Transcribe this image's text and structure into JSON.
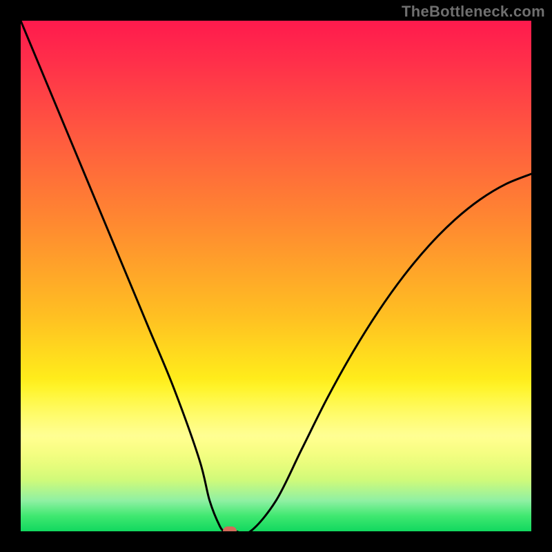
{
  "watermark": "TheBottleneck.com",
  "colors": {
    "frame": "#000000",
    "curve_stroke": "#000000",
    "marker_fill": "#d36b5a",
    "gradient_top": "#ff1a4d",
    "gradient_bottom": "#12d85f",
    "watermark_text": "#6f6f6f"
  },
  "chart_data": {
    "type": "line",
    "title": "",
    "xlabel": "",
    "ylabel": "",
    "xlim": [
      0,
      100
    ],
    "ylim": [
      0,
      100
    ],
    "grid": false,
    "series": [
      {
        "name": "bottleneck-curve",
        "x": [
          0,
          5,
          10,
          15,
          20,
          25,
          30,
          35,
          37,
          39,
          40,
          41,
          42,
          45,
          50,
          55,
          60,
          65,
          70,
          75,
          80,
          85,
          90,
          95,
          100
        ],
        "y": [
          100,
          88,
          76,
          64,
          52,
          40,
          28,
          14,
          6,
          1,
          0,
          0,
          0,
          0,
          6,
          16,
          26,
          35,
          43,
          50,
          56,
          61,
          65,
          68,
          70
        ]
      }
    ],
    "marker": {
      "x": 41,
      "y": 0
    },
    "description": "V-shaped bottleneck curve over a red-to-green vertical gradient; minimum (optimal point) near x≈41% where bottleneck ≈ 0%. Left branch rises steeply to 100% at x=0; right branch rises to about 70% at x=100."
  }
}
